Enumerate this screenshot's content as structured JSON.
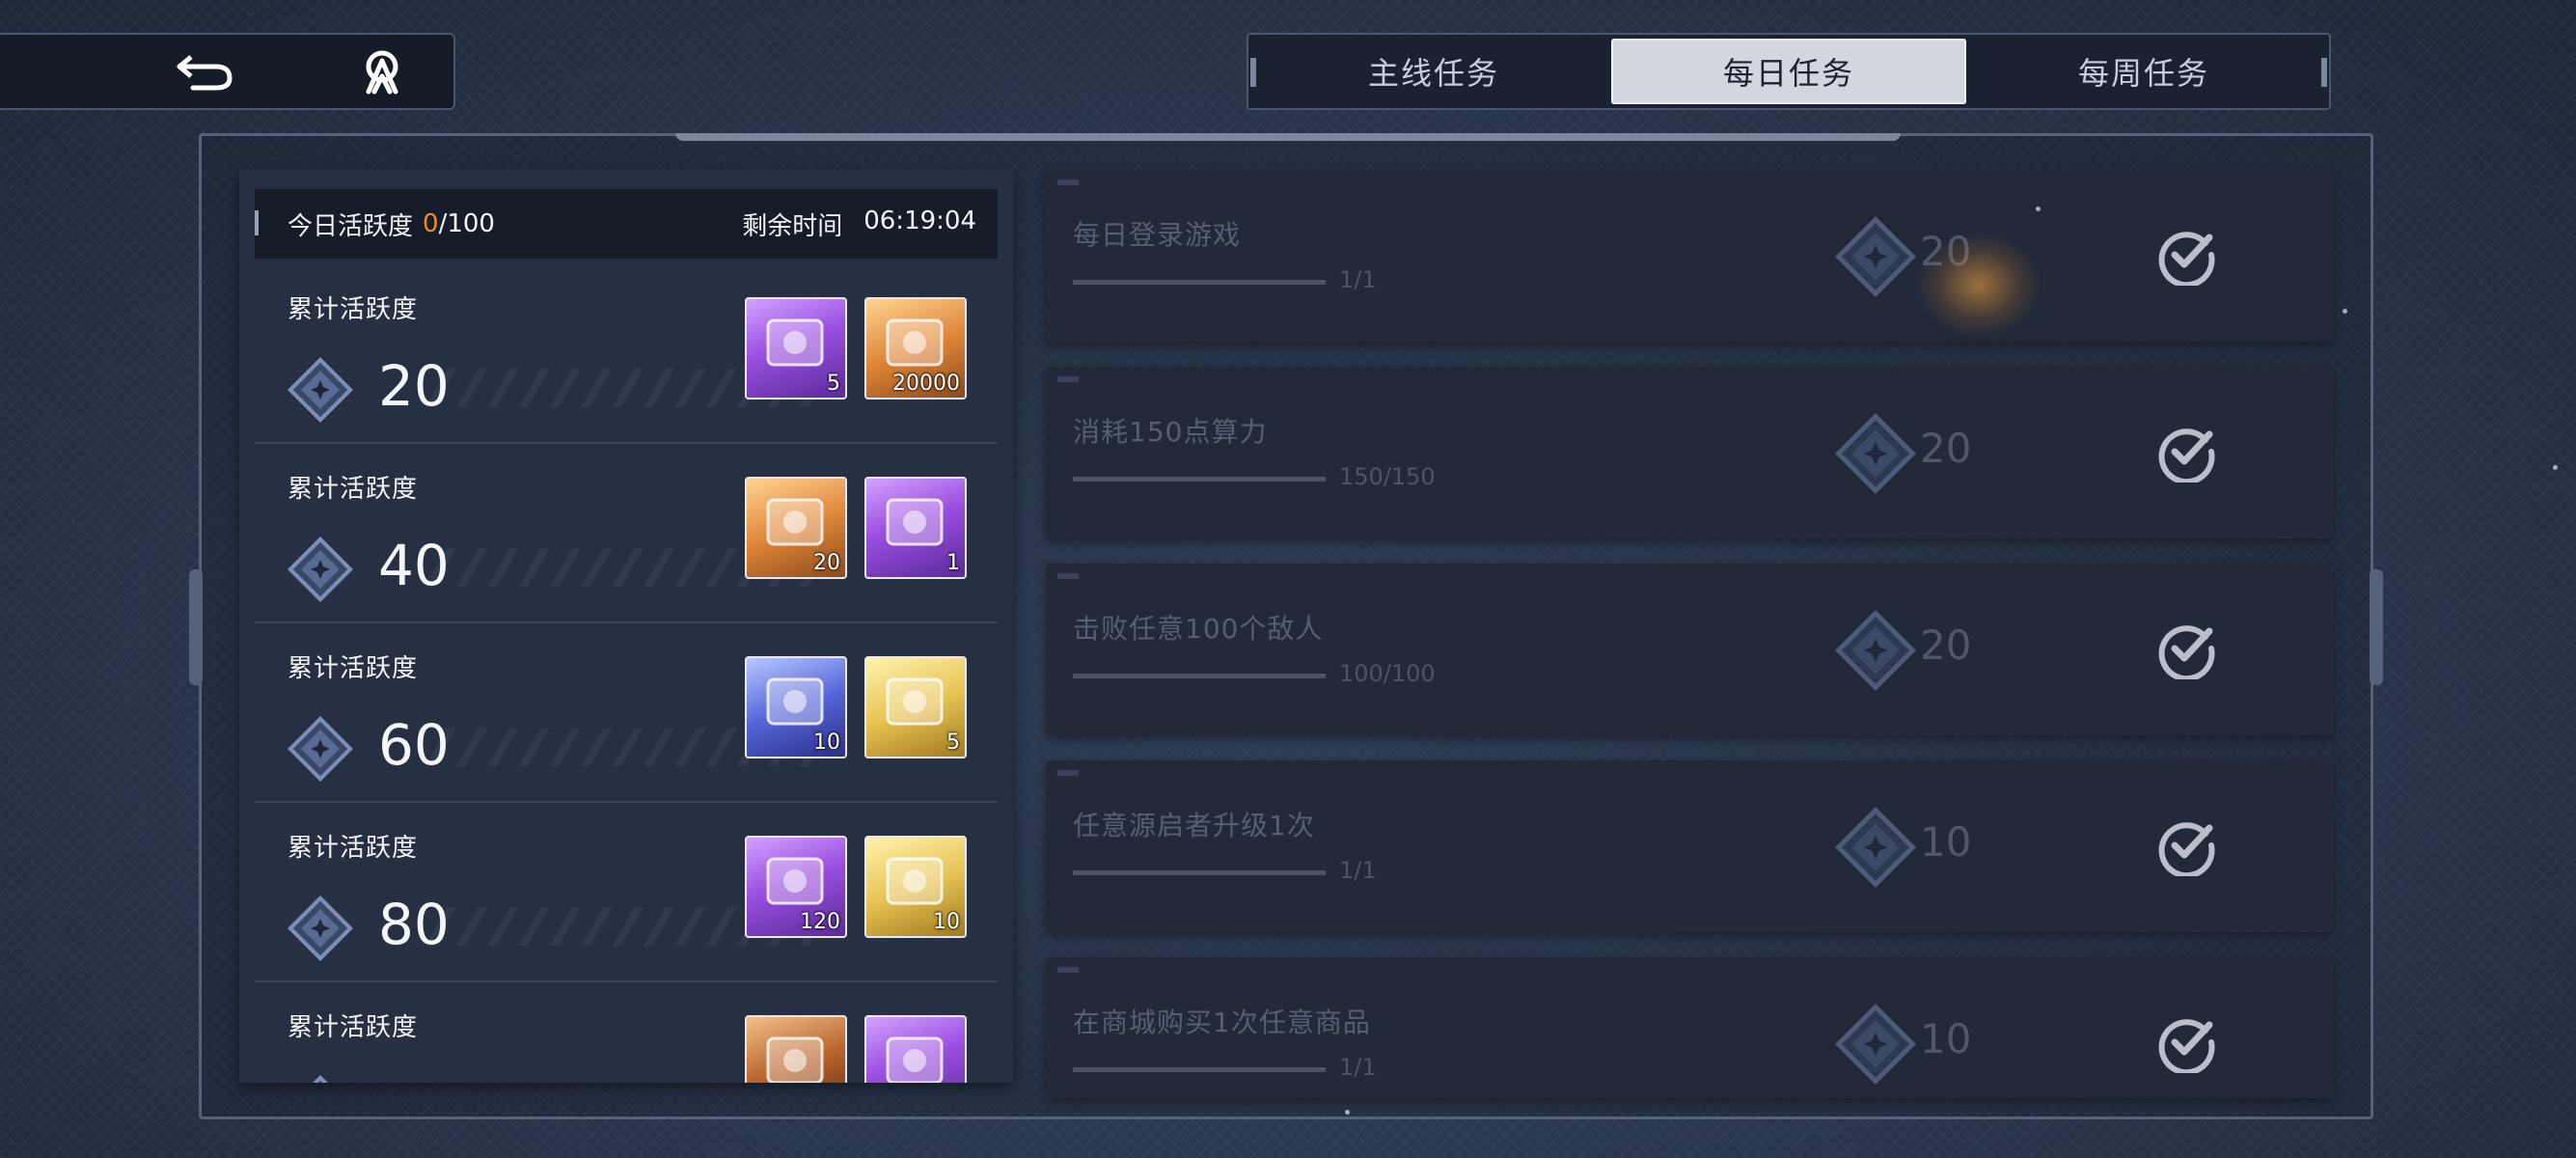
{
  "nav": {
    "back_icon": "return-arrow-icon",
    "home_icon": "hub-logo-icon"
  },
  "tabs": [
    {
      "label": "主线任务",
      "active": false
    },
    {
      "label": "每日任务",
      "active": true
    },
    {
      "label": "每周任务",
      "active": false
    }
  ],
  "activity": {
    "label": "今日活跃度",
    "current": "0",
    "max": "/100",
    "remaining_label": "剩余时间",
    "remaining_time": "06:19:04"
  },
  "milestones": [
    {
      "label": "累计活跃度",
      "value": "20",
      "rewards": [
        {
          "qty": "5",
          "style": "purple",
          "icon": "ticket-card-icon"
        },
        {
          "qty": "20000",
          "style": "orange",
          "icon": "credit-chip-icon"
        }
      ]
    },
    {
      "label": "累计活跃度",
      "value": "40",
      "rewards": [
        {
          "qty": "20",
          "style": "orange",
          "icon": "blue-star-crystal-icon"
        },
        {
          "qty": "1",
          "style": "purple",
          "icon": "mystery-chest-icon"
        }
      ]
    },
    {
      "label": "累计活跃度",
      "value": "60",
      "rewards": [
        {
          "qty": "10",
          "style": "blue",
          "icon": "crystal-shard-icon"
        },
        {
          "qty": "5",
          "style": "gold",
          "icon": "battery-device-icon"
        }
      ]
    },
    {
      "label": "累计活跃度",
      "value": "80",
      "rewards": [
        {
          "qty": "120",
          "style": "purple",
          "icon": "planet-orb-icon"
        },
        {
          "qty": "10",
          "style": "gold",
          "icon": "amber-gem-icon"
        }
      ]
    },
    {
      "label": "累计活跃度",
      "value": "",
      "rewards": [
        {
          "qty": "",
          "style": "bronze",
          "icon": "ticket-card-icon"
        },
        {
          "qty": "",
          "style": "purple",
          "icon": "vial-icon"
        }
      ]
    }
  ],
  "tasks": [
    {
      "title": "每日登录游戏",
      "progress": "1/1",
      "fraction": 1.0,
      "points": "20",
      "completed": true
    },
    {
      "title": "消耗150点算力",
      "progress": "150/150",
      "fraction": 1.0,
      "points": "20",
      "completed": true
    },
    {
      "title": "击败任意100个敌人",
      "progress": "100/100",
      "fraction": 1.0,
      "points": "20",
      "completed": true
    },
    {
      "title": "任意源启者升级1次",
      "progress": "1/1",
      "fraction": 1.0,
      "points": "10",
      "completed": true
    },
    {
      "title": "在商城购买1次任意商品",
      "progress": "1/1",
      "fraction": 1.0,
      "points": "10",
      "completed": true
    }
  ],
  "colors": {
    "accent_orange": "#f08a2c",
    "active_tab_bg": "#d2d6de",
    "panel_bg": "#263042",
    "task_bg": "#222a3a"
  }
}
